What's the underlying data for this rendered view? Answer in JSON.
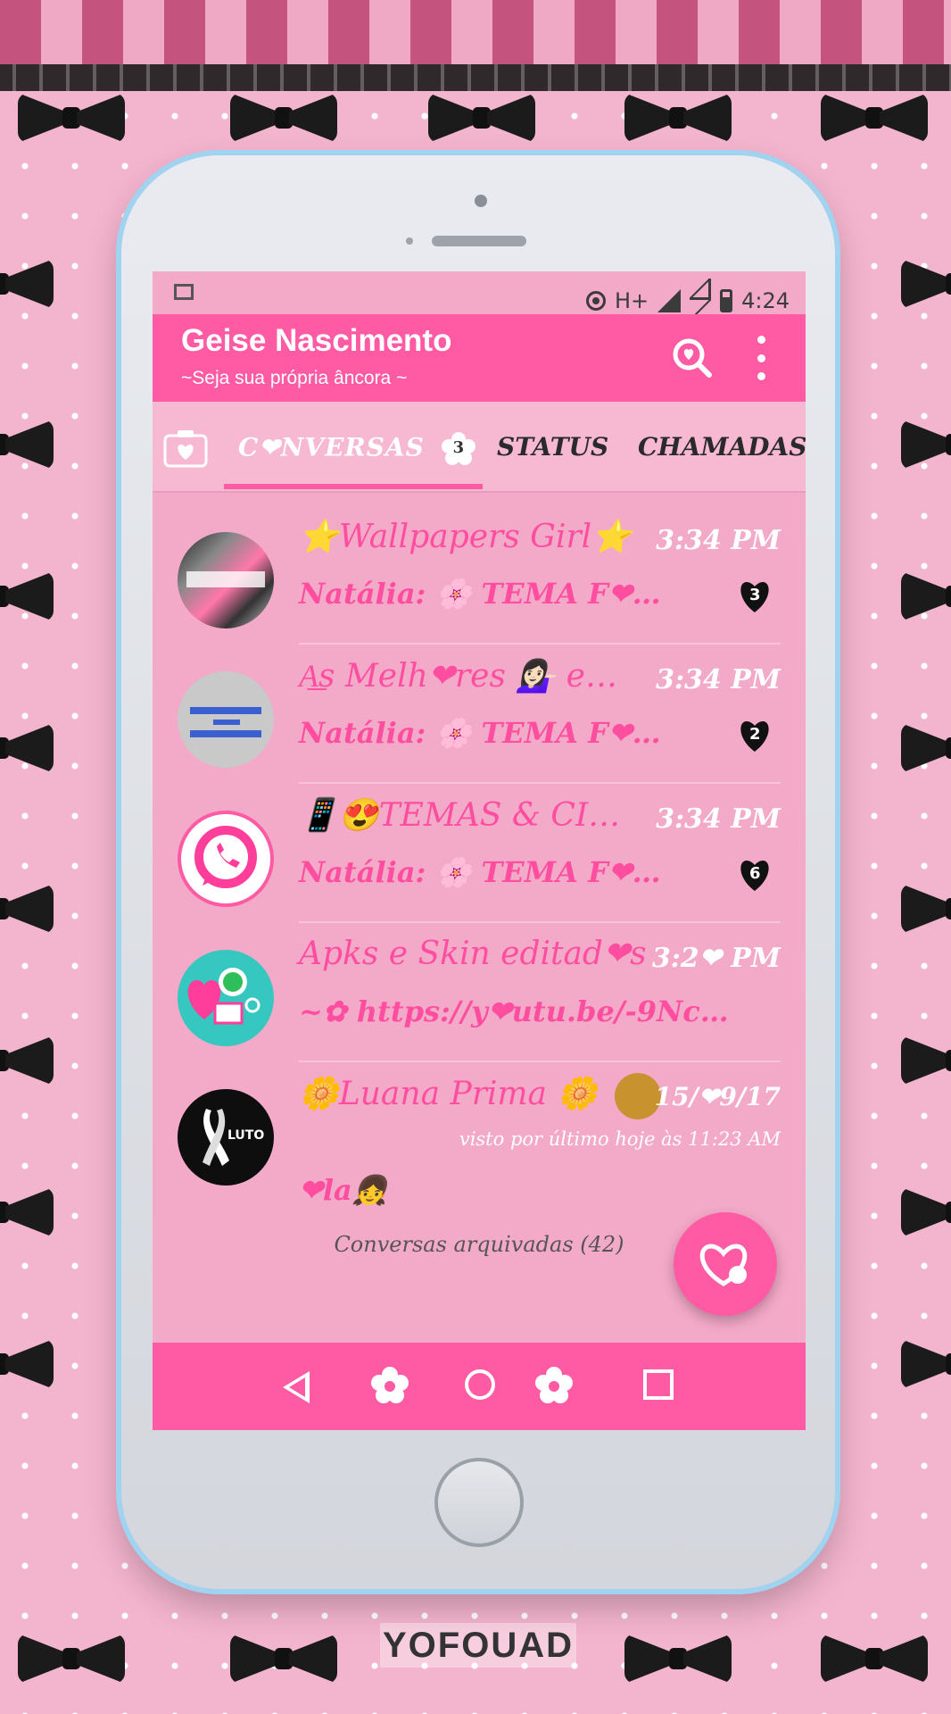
{
  "status_bar": {
    "network": "H+",
    "time": "4:24"
  },
  "app_bar": {
    "title": "Geise Nascimento",
    "subtitle": "~Seja sua própria âncora ~"
  },
  "tabs": [
    {
      "label": "C❤NVERSAS",
      "badge": "3",
      "active": true
    },
    {
      "label": "STATUS",
      "active": false
    },
    {
      "label": "CHAMADAS",
      "active": false
    }
  ],
  "chats": [
    {
      "name": "⭐Wallpapers Girl⭐",
      "time": "3:34 PM",
      "message": "Natália: 🌸 TEMA F❤…",
      "unread": "3"
    },
    {
      "name": "A͟s Melh❤res 💁🏻‍♀️ e…",
      "time": "3:34 PM",
      "message": "Natália: 🌸 TEMA F❤…",
      "unread": "2"
    },
    {
      "name": "📱😍TEMAS & CI…",
      "time": "3:34 PM",
      "message": "Natália: 🌸 TEMA F❤…",
      "unread": "6"
    },
    {
      "name": "Apks e Skin editad❤s",
      "time": "3:2❤ PM",
      "message": "~✿ https://y❤utu.be/-9Nc…",
      "unread": ""
    },
    {
      "name": "🌼Luana Prima 🌼",
      "time": "15/❤9/17",
      "status": "visto por último hoje às 11:23 AM",
      "message": "❤la👧",
      "unread": ""
    }
  ],
  "archived": "Conversas arquivadas (42)",
  "watermark": "YOFOUAD",
  "colors": {
    "accent": "#ff5ba4",
    "screen_bg": "#f3a9c8",
    "text_pink": "#ff4da0"
  }
}
